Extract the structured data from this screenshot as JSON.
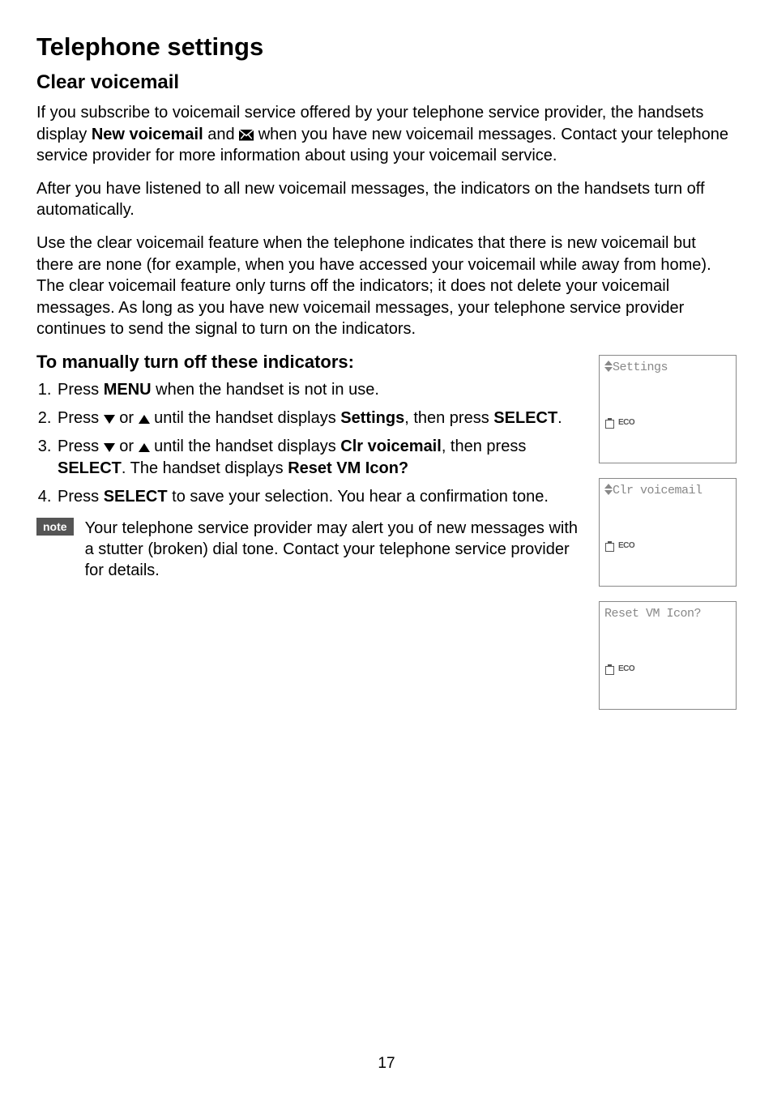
{
  "title": "Telephone settings",
  "section_heading": "Clear voicemail",
  "para1_a": "If you subscribe to voicemail service offered by your telephone service provider, the handsets display ",
  "para1_bold": "New voicemail",
  "para1_b": " and ",
  "para1_c": " when you have new voicemail messages. Contact your telephone service provider for more information about using your voicemail service.",
  "para2": "After you have listened to all new voicemail messages, the indicators on the handsets turn off automatically.",
  "para3": "Use the clear voicemail feature when the telephone indicates that there is new voicemail but there are none (for example, when you have accessed your voicemail while away from home). The clear voicemail feature only turns off the indicators; it does not delete your voicemail messages. As long as you have new voicemail messages, your telephone service provider continues to send the signal to turn on the indicators.",
  "subheading": "To manually turn off these indicators:",
  "steps": {
    "s1_a": "Press ",
    "s1_menu": "MENU",
    "s1_b": " when the handset is not in use.",
    "s2_a": "Press ",
    "s2_or": " or ",
    "s2_b": " until the handset displays ",
    "s2_settings": "Settings",
    "s2_c": ", then press ",
    "s2_select": "SELECT",
    "s2_d": ".",
    "s3_a": "Press ",
    "s3_or": " or ",
    "s3_b": " until the handset displays ",
    "s3_clr": "Clr voicemail",
    "s3_c": ", then press ",
    "s3_select": "SELECT",
    "s3_d": ". The handset displays ",
    "s3_reset": "Reset VM Icon?",
    "s4_a": "Press ",
    "s4_select": "SELECT",
    "s4_b": " to save your selection. You hear a confirmation tone."
  },
  "note_label": "note",
  "note_text": "Your telephone service provider may alert you of new messages with a stutter (broken) dial tone. Contact your telephone service provider for details.",
  "screens": {
    "s1": "Settings",
    "s2": "Clr voicemail",
    "s3": "Reset VM Icon?",
    "eco": "ECO"
  },
  "page_number": "17"
}
